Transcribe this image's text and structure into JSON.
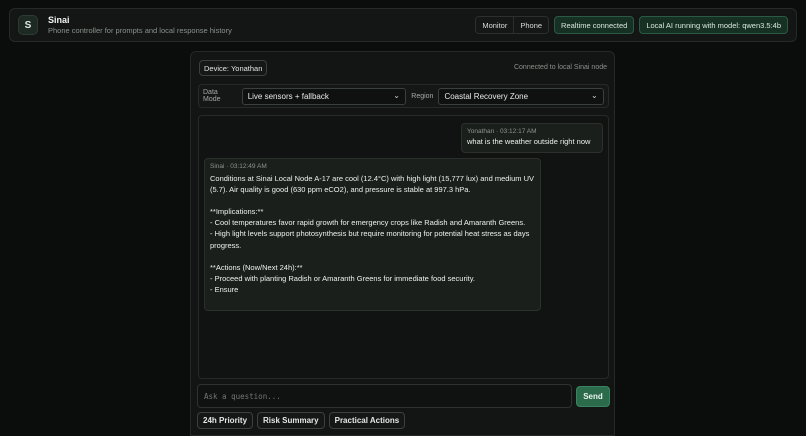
{
  "app": {
    "logo_letter": "S",
    "title": "Sinai",
    "subtitle": "Phone controller for prompts and local response history"
  },
  "header": {
    "view_tabs": [
      "Monitor",
      "Phone"
    ],
    "realtime_status": "Realtime connected",
    "ai_status": "Local AI running with model: qwen3.5:4b"
  },
  "device": {
    "label": "Device: Yonathan",
    "connection": "Connected to local Sinai node"
  },
  "controls": {
    "data_mode_label": "Data Mode",
    "data_mode_value": "Live sensors + fallback",
    "region_label": "Region",
    "region_value": "Coastal Recovery Zone"
  },
  "messages": {
    "user": {
      "meta": "Yonathan · 03:12:17 AM",
      "text": "what is the weather outside right now"
    },
    "ai": {
      "meta": "Sinai · 03:12:49 AM",
      "text": "Conditions at Sinai Local Node A-17 are cool (12.4°C) with high light (15,777 lux) and medium UV (5.7). Air quality is good (630 ppm eCO2), and pressure is stable at 997.3 hPa.\n\n**Implications:**\n- Cool temperatures favor rapid growth for emergency crops like Radish and Amaranth Greens.\n- High light levels support photosynthesis but require monitoring for potential heat stress as days progress.\n\n**Actions (Now/Next 24h):**\n- Proceed with planting Radish or Amaranth Greens for immediate food security.\n- Ensure"
    }
  },
  "composer": {
    "placeholder": "Ask a question...",
    "send_label": "Send"
  },
  "quick_actions": [
    "24h Priority",
    "Risk Summary",
    "Practical Actions"
  ],
  "icons": {
    "select_chevron": "chevron-down-icon"
  }
}
